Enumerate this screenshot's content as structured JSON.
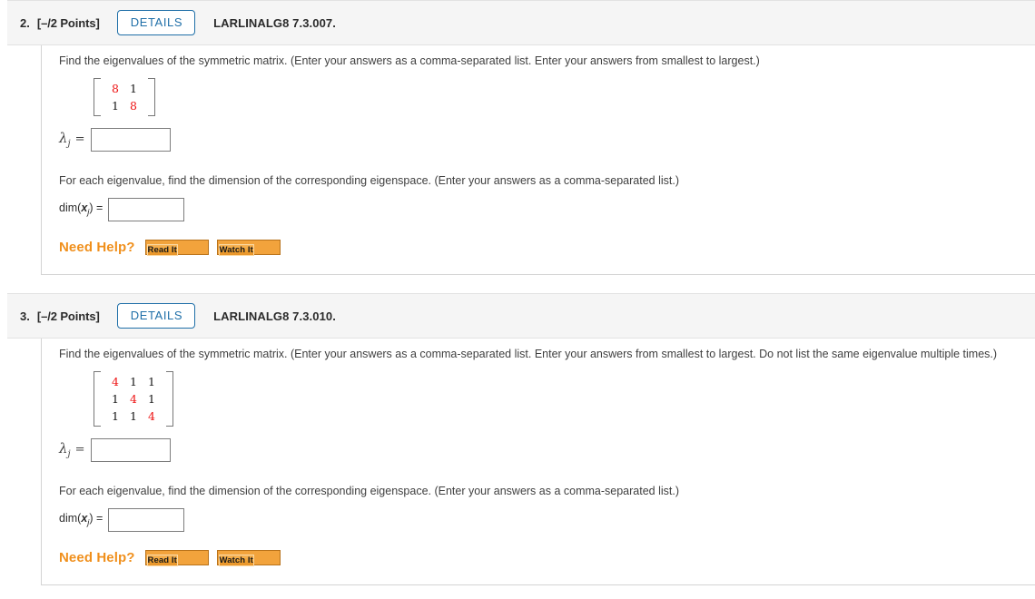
{
  "page": {
    "background_color": "#ffffff",
    "accent_blue": "#1f6fa8",
    "need_help_orange": "#f0901d",
    "matrix_diagonal_color": "#ee1111"
  },
  "questions": [
    {
      "number": "2.",
      "points": "[–/2 Points]",
      "details_label": "DETAILS",
      "code": "LARLINALG8 7.3.007.",
      "prompt_1": "Find the eigenvalues of the symmetric matrix. (Enter your answers as a comma-separated list. Enter your answers from smallest to largest.)",
      "matrix": {
        "rows": [
          [
            "8",
            "1"
          ],
          [
            "1",
            "8"
          ]
        ],
        "size": 2
      },
      "eigen_label": "λ",
      "eigen_sub": "j",
      "eigen_equals": "=",
      "eigen_value": "",
      "eigen_placeholder": "",
      "prompt_2": "For each eigenvalue, find the dimension of the corresponding eigenspace. (Enter your answers as a comma-separated list.)",
      "dim_prefix": "dim(",
      "dim_var": "x",
      "dim_sub": "j",
      "dim_suffix": ") =",
      "dim_value": "",
      "dim_placeholder": "",
      "need_help_label": "Need Help?",
      "read_it_label": "Read It",
      "watch_it_label": "Watch It"
    },
    {
      "number": "3.",
      "points": "[–/2 Points]",
      "details_label": "DETAILS",
      "code": "LARLINALG8 7.3.010.",
      "prompt_1": "Find the eigenvalues of the symmetric matrix. (Enter your answers as a comma-separated list. Enter your answers from smallest to largest. Do not list the same eigenvalue multiple times.)",
      "matrix": {
        "rows": [
          [
            "4",
            "1",
            "1"
          ],
          [
            "1",
            "4",
            "1"
          ],
          [
            "1",
            "1",
            "4"
          ]
        ],
        "size": 3
      },
      "eigen_label": "λ",
      "eigen_sub": "j",
      "eigen_equals": "=",
      "eigen_value": "",
      "eigen_placeholder": "",
      "prompt_2": "For each eigenvalue, find the dimension of the corresponding eigenspace. (Enter your answers as a comma-separated list.)",
      "dim_prefix": "dim(",
      "dim_var": "x",
      "dim_sub": "j",
      "dim_suffix": ") =",
      "dim_value": "",
      "dim_placeholder": "",
      "need_help_label": "Need Help?",
      "read_it_label": "Read It",
      "watch_it_label": "Watch It"
    }
  ]
}
